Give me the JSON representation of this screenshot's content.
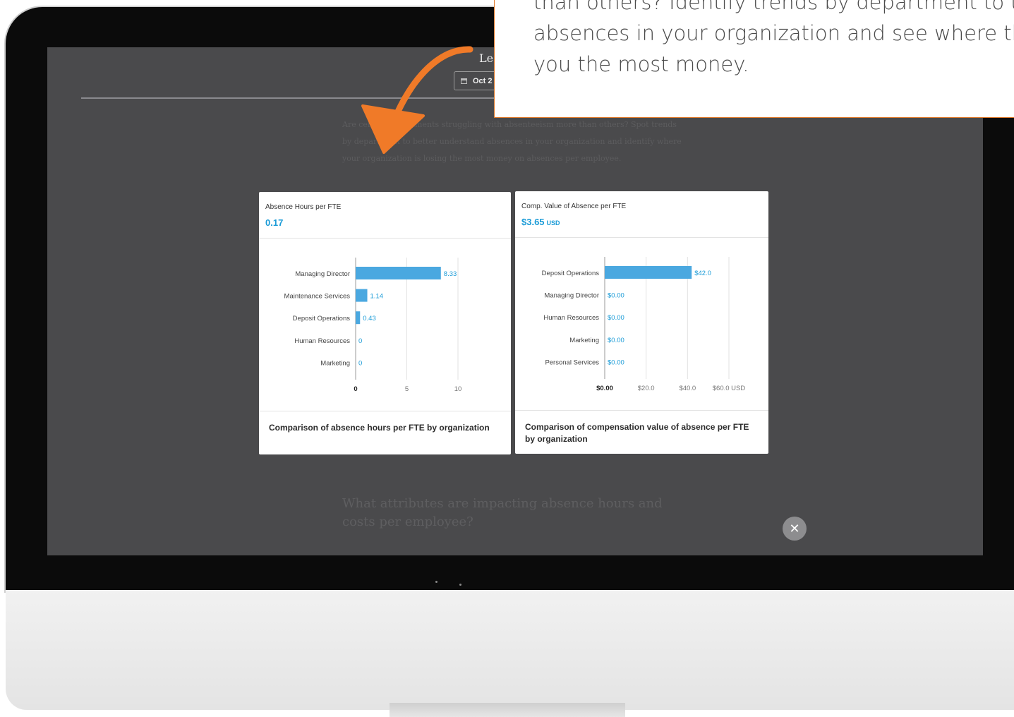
{
  "page": {
    "header_title": "Lea",
    "date_label": "Oct 2",
    "intro_text": "Are certain departments struggling with absenteeism more than others? Spot trends by department to better understand absences in your organization and identify where your organization is losing the most money on absences per employee.",
    "question_text": "What attributes are impacting absence hours and costs per employee?",
    "close_label": "✕"
  },
  "callout": {
    "lines": [
      "than others? Identify trends by department to und",
      "absences in your organization and see where they",
      "you the most money."
    ],
    "border_color": "#e07a2b",
    "arrow_color": "#f07a28"
  },
  "cards": [
    {
      "title": "Absence Hours per FTE",
      "value": "0.17",
      "unit": "",
      "footer": "Comparison of absence hours per FTE by organization"
    },
    {
      "title": "Comp. Value of Absence per FTE",
      "value": "$3.65",
      "unit": "USD",
      "footer": "Comparison of compensation value of absence per FTE by organization"
    }
  ],
  "chart_data": [
    {
      "type": "bar",
      "orientation": "horizontal",
      "categories": [
        "Managing Director",
        "Maintenance Services",
        "Deposit Operations",
        "Human Resources",
        "Marketing"
      ],
      "values": [
        8.33,
        1.14,
        0.43,
        0,
        0
      ],
      "value_labels": [
        "8.33",
        "1.14",
        "0.43",
        "0",
        "0"
      ],
      "xlim": [
        0,
        10
      ],
      "x_ticks": [
        "0",
        "5",
        "10"
      ],
      "grid": true,
      "bar_color": "#4aa8e0"
    },
    {
      "type": "bar",
      "orientation": "horizontal",
      "categories": [
        "Deposit Operations",
        "Managing Director",
        "Human Resources",
        "Marketing",
        "Personal Services"
      ],
      "values": [
        42.0,
        0,
        0,
        0,
        0
      ],
      "value_labels": [
        "$42.0",
        "$0.00",
        "$0.00",
        "$0.00",
        "$0.00"
      ],
      "xlim": [
        0,
        60
      ],
      "x_ticks": [
        "$0.00",
        "$20.0",
        "$40.0",
        "$60.0 USD"
      ],
      "grid": true,
      "bar_color": "#4aa8e0"
    }
  ]
}
